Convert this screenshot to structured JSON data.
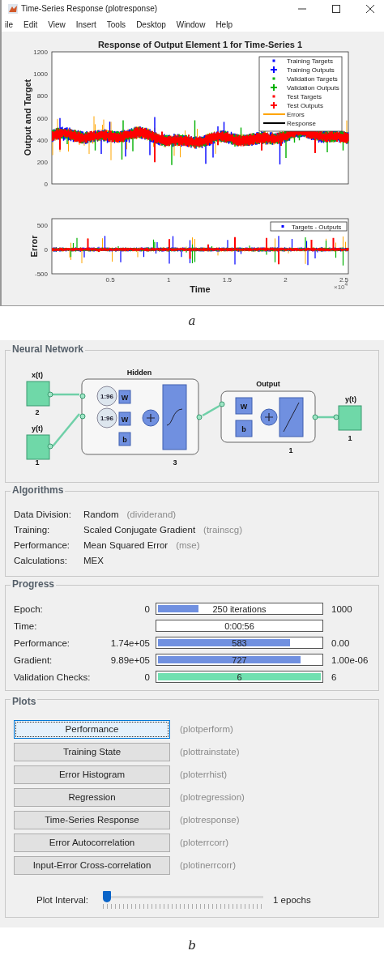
{
  "figure_a": {
    "window": {
      "title": "Time-Series Response (plotresponse)"
    },
    "menu": [
      "ile",
      "Edit",
      "View",
      "Insert",
      "Tools",
      "Desktop",
      "Window",
      "Help"
    ],
    "plot": {
      "title": "Response of Output Element 1 for Time-Series 1",
      "ylabel": "Output and Target",
      "yticks": [
        "1200",
        "1000",
        "800",
        "600",
        "400",
        "200",
        "0"
      ],
      "legend": [
        {
          "label": "Training Targets",
          "kind": "dot",
          "color": "#0000ff"
        },
        {
          "label": "Training Outputs",
          "kind": "plus",
          "color": "#0000ff"
        },
        {
          "label": "Validation Targets",
          "kind": "dot",
          "color": "#00b000"
        },
        {
          "label": "Validation Outputs",
          "kind": "plus",
          "color": "#00b000"
        },
        {
          "label": "Test Targets",
          "kind": "dot",
          "color": "#ff0000"
        },
        {
          "label": "Test Outputs",
          "kind": "plus",
          "color": "#ff0000"
        },
        {
          "label": "Errors",
          "kind": "line",
          "color": "#ffa500"
        },
        {
          "label": "Response",
          "kind": "line",
          "color": "#000000"
        }
      ]
    },
    "error_plot": {
      "ylabel": "Error",
      "yticks": [
        "500",
        "0",
        "-500"
      ],
      "legend": [
        {
          "label": "Targets - Outputs",
          "kind": "dot",
          "color": "#0000ff"
        }
      ],
      "xticks": [
        "0.5",
        "1",
        "1.5",
        "2",
        "2.5"
      ],
      "xlabel": "Time",
      "multiplier": "×10$^{4}$"
    },
    "caption": "a"
  },
  "figure_b": {
    "network": {
      "title": "Neural Network",
      "inputs": [
        {
          "name": "x(t)",
          "size": "2"
        },
        {
          "name": "y(t)",
          "size": "1"
        }
      ],
      "hidden": {
        "title": "Hidden",
        "delays": [
          "1:96",
          "1:96"
        ],
        "weights": [
          "W",
          "W"
        ],
        "bias": "b",
        "size": "3"
      },
      "output_layer": {
        "title": "Output",
        "weight": "W",
        "bias": "b",
        "size": "1"
      },
      "output": {
        "name": "y(t)",
        "size": "1"
      }
    },
    "algorithms": {
      "title": "Algorithms",
      "rows": [
        {
          "label": "Data Division:",
          "value": "Random",
          "function": "(dividerand)"
        },
        {
          "label": "Training:",
          "value": "Scaled Conjugate Gradient",
          "function": "(trainscg)"
        },
        {
          "label": "Performance:",
          "value": "Mean Squared Error",
          "function": "(mse)"
        },
        {
          "label": "Calculations:",
          "value": "MEX"
        }
      ]
    },
    "progress": {
      "title": "Progress",
      "rows": [
        {
          "label": "Epoch:",
          "start": "0",
          "bar": "250 iterations",
          "end": "1000",
          "kind": "meter",
          "level": 0.25,
          "color": "#7090e0"
        },
        {
          "label": "Time:",
          "bar": "0:00:56",
          "kind": "text"
        },
        {
          "label": "Performance:",
          "start": "1.74e+05",
          "bar": "583",
          "end": "0.00",
          "kind": "meter",
          "level": 0.81,
          "color": "#7090e0"
        },
        {
          "label": "Gradient:",
          "start": "9.89e+05",
          "bar": "727",
          "end": "1.00e-06",
          "kind": "meter",
          "level": 0.875,
          "color": "#7090e0"
        },
        {
          "label": "Validation Checks:",
          "start": "0",
          "bar": "6",
          "end": "6",
          "kind": "meter",
          "level": 1,
          "color": "#70e0b0"
        }
      ]
    },
    "plots": {
      "title": "Plots",
      "buttons": [
        {
          "label": "Performance",
          "function": "(plotperform)",
          "selected": true
        },
        {
          "label": "Training State",
          "function": "(plottrainstate)",
          "selected": false
        },
        {
          "label": "Error Histogram",
          "function": "(ploterrhist)",
          "selected": false
        },
        {
          "label": "Regression",
          "function": "(plotregression)",
          "selected": false
        },
        {
          "label": "Time-Series Response",
          "function": "(plotresponse)",
          "selected": false
        },
        {
          "label": "Error Autocorrelation",
          "function": "(ploterrcorr)",
          "selected": false
        },
        {
          "label": "Input-Error Cross-correlation",
          "function": "(plotinerrcorr)",
          "selected": false
        }
      ],
      "slider": {
        "label": "Plot Interval:",
        "level": 0,
        "reading": "1 epochs"
      }
    },
    "caption": "b"
  }
}
